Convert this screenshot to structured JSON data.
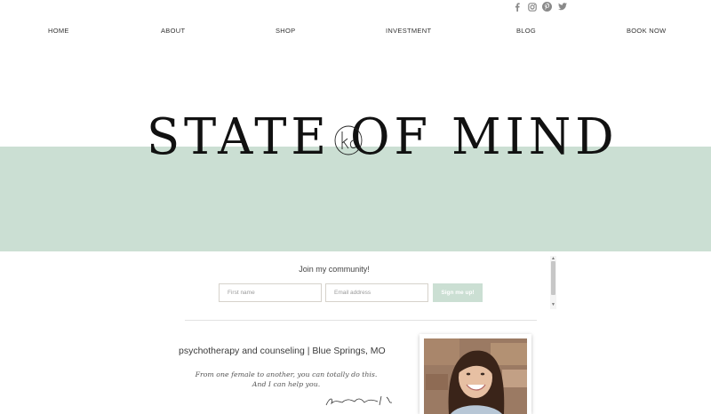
{
  "social": {
    "icons": [
      "facebook-icon",
      "instagram-icon",
      "pinterest-icon",
      "twitter-icon"
    ]
  },
  "nav": {
    "items": [
      "HOME",
      "ABOUT",
      "SHOP",
      "INVESTMENT",
      "BLOG",
      "BOOK NOW"
    ]
  },
  "hero": {
    "logo_text": "STATE OF MIND",
    "monogram": "kc",
    "band_color": "#cbdfd3"
  },
  "signup": {
    "label": "Join my community!",
    "first_name_placeholder": "First name",
    "email_placeholder": "Email address",
    "button_label": "Sign me up!"
  },
  "about": {
    "tagline": "psychotherapy and counseling | Blue Springs, MO",
    "quote_line1": "From one female to another, you can totally do this.",
    "quote_line2": "And I can help you."
  }
}
